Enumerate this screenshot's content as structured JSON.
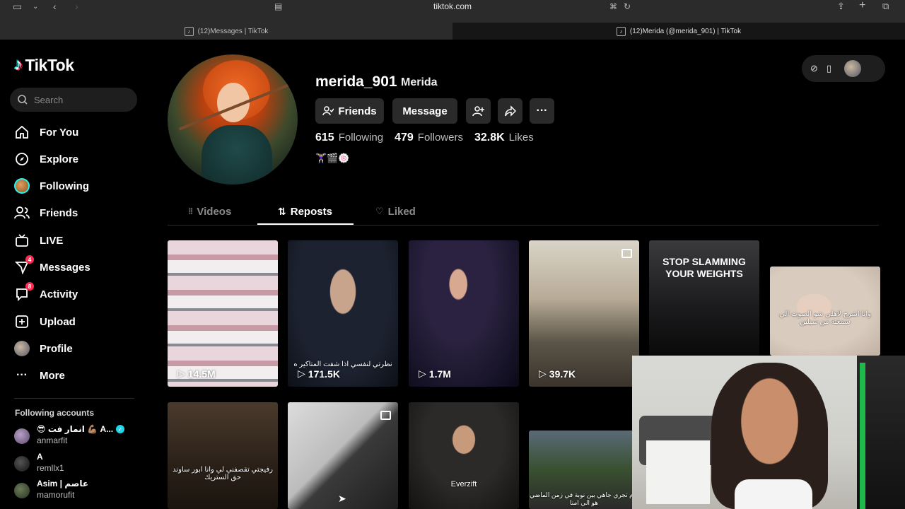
{
  "browser": {
    "url": "tiktok.com",
    "tabs": [
      {
        "title": "(12)Messages | TikTok"
      },
      {
        "title": "(12)Merida (@merida_901) | TikTok"
      }
    ]
  },
  "sidebar": {
    "logo_text": "TikTok",
    "search_placeholder": "Search",
    "nav": [
      {
        "label": "For You",
        "icon": "home-icon"
      },
      {
        "label": "Explore",
        "icon": "compass-icon"
      },
      {
        "label": "Following",
        "icon": "following-avatar"
      },
      {
        "label": "Friends",
        "icon": "friends-icon"
      },
      {
        "label": "LIVE",
        "icon": "live-icon"
      },
      {
        "label": "Messages",
        "icon": "messages-icon",
        "badge": "4"
      },
      {
        "label": "Activity",
        "icon": "activity-icon",
        "badge": "8"
      },
      {
        "label": "Upload",
        "icon": "upload-icon"
      },
      {
        "label": "Profile",
        "icon": "profile-avatar"
      },
      {
        "label": "More",
        "icon": "more-icon"
      }
    ],
    "following_accounts_title": "Following accounts",
    "following_accounts": [
      {
        "name": "😎 انمار فت 💪🏽 A...",
        "username": "anmarfit",
        "verified": true
      },
      {
        "name": "A",
        "username": "remllx1",
        "verified": false
      },
      {
        "name": "Asim | عاصم",
        "username": "mamorufit",
        "verified": false
      }
    ]
  },
  "profile": {
    "username": "merida_901",
    "nickname": "Merida",
    "buttons": {
      "friends": "Friends",
      "message": "Message"
    },
    "stats": {
      "following_count": "615",
      "following_label": "Following",
      "followers_count": "479",
      "followers_label": "Followers",
      "likes_count": "32.8K",
      "likes_label": "Likes"
    },
    "bio": "🏋🏻‍♀️🎬🍥"
  },
  "tabs": [
    {
      "label": "Videos"
    },
    {
      "label": "Reposts"
    },
    {
      "label": "Liked"
    }
  ],
  "active_tab": "Reposts",
  "videos": [
    {
      "views": "14.5M"
    },
    {
      "views": "171.5K",
      "caption": "نظرتي لنفسي اذا شفت المتاكير ه"
    },
    {
      "views": "1.7M"
    },
    {
      "views": "39.7K"
    },
    {
      "overlay": "STOP SLAMMING YOUR WEIGHTS"
    },
    {
      "caption": "وانا اشرح لاهلي شو الصوت الي سمعته من سيلين"
    },
    {
      "caption": "رفيجتي تقصفني لي وانا ابور ساوند حق الستريك"
    },
    {},
    {
      "caption": "Everzift"
    },
    {
      "caption": "يوم تجري جاهي بين نوبة في زمن الماضي هو الي امنا"
    }
  ],
  "colors": {
    "accent": "#fe2c55",
    "cyan": "#25f4ee",
    "background": "#000000",
    "button": "#2a2a2a"
  }
}
